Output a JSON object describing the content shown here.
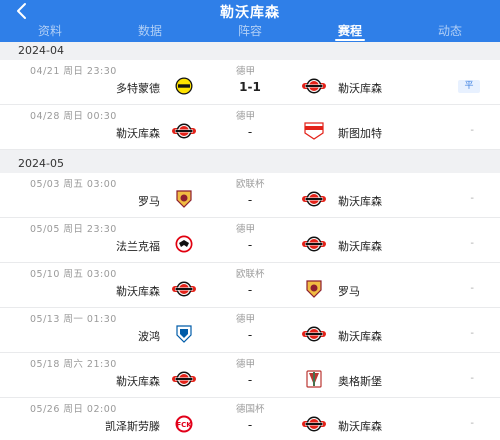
{
  "header": {
    "title": "勒沃库森",
    "back_icon": "chevron-left-icon"
  },
  "tabs": [
    {
      "label": "资料",
      "active": false
    },
    {
      "label": "数据",
      "active": false
    },
    {
      "label": "阵容",
      "active": false
    },
    {
      "label": "赛程",
      "active": true
    },
    {
      "label": "动态",
      "active": false
    }
  ],
  "months": [
    {
      "label": "2024-04",
      "matches": [
        {
          "date": "04/21  周日 23:30",
          "competition": "德甲",
          "home": "多特蒙德",
          "home_logo": "dortmund-logo",
          "score": "1-1",
          "away": "勒沃库森",
          "away_logo": "leverkusen-logo",
          "result": "平"
        },
        {
          "date": "04/28  周日 00:30",
          "competition": "德甲",
          "home": "勒沃库森",
          "home_logo": "leverkusen-logo",
          "score": "-",
          "away": "斯图加特",
          "away_logo": "stuttgart-logo",
          "result": "-"
        }
      ]
    },
    {
      "label": "2024-05",
      "matches": [
        {
          "date": "05/03  周五 03:00",
          "competition": "欧联杯",
          "home": "罗马",
          "home_logo": "roma-logo",
          "score": "-",
          "away": "勒沃库森",
          "away_logo": "leverkusen-logo",
          "result": "-"
        },
        {
          "date": "05/05  周日 23:30",
          "competition": "德甲",
          "home": "法兰克福",
          "home_logo": "frankfurt-logo",
          "score": "-",
          "away": "勒沃库森",
          "away_logo": "leverkusen-logo",
          "result": "-"
        },
        {
          "date": "05/10  周五 03:00",
          "competition": "欧联杯",
          "home": "勒沃库森",
          "home_logo": "leverkusen-logo",
          "score": "-",
          "away": "罗马",
          "away_logo": "roma-logo",
          "result": "-"
        },
        {
          "date": "05/13  周一 01:30",
          "competition": "德甲",
          "home": "波鸿",
          "home_logo": "bochum-logo",
          "score": "-",
          "away": "勒沃库森",
          "away_logo": "leverkusen-logo",
          "result": "-"
        },
        {
          "date": "05/18  周六 21:30",
          "competition": "德甲",
          "home": "勒沃库森",
          "home_logo": "leverkusen-logo",
          "score": "-",
          "away": "奥格斯堡",
          "away_logo": "augsburg-logo",
          "result": "-"
        },
        {
          "date": "05/26  周日 02:00",
          "competition": "德国杯",
          "home": "凯泽斯劳滕",
          "home_logo": "kaiserslautern-logo",
          "score": "-",
          "away": "勒沃库森",
          "away_logo": "leverkusen-logo",
          "result": "-"
        }
      ]
    }
  ],
  "colors": {
    "brand": "#2f7fe8",
    "draw_badge_bg": "#e8f1ff",
    "draw_badge_text": "#3a7ee0"
  }
}
